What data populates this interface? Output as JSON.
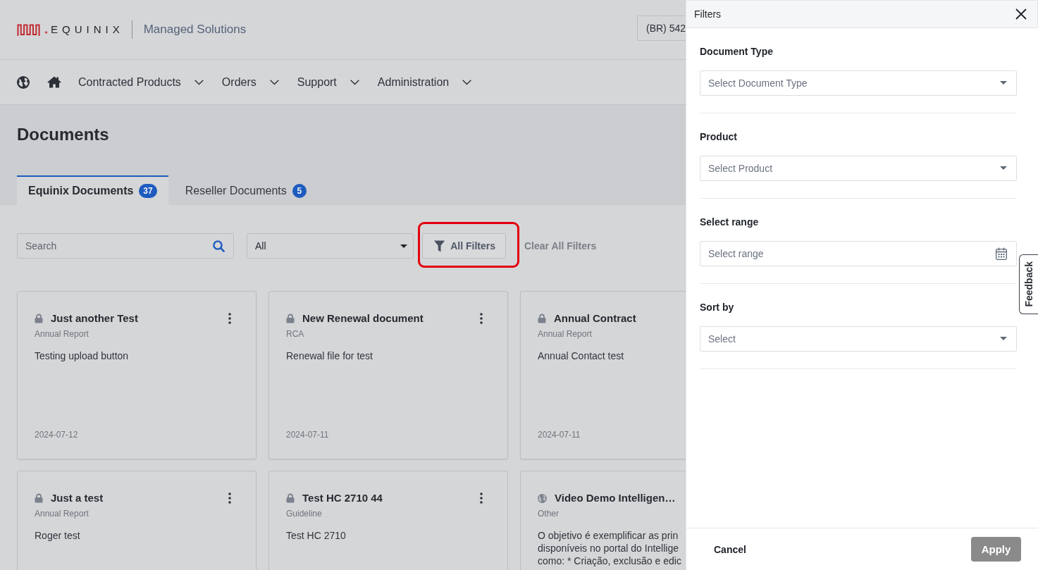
{
  "header": {
    "logo_text": "EQUINIX",
    "product_name": "Managed Solutions",
    "account": "(BR) 542"
  },
  "nav": {
    "items": [
      "Contracted Products",
      "Orders",
      "Support",
      "Administration"
    ]
  },
  "page": {
    "title": "Documents"
  },
  "tabs": [
    {
      "label": "Equinix Documents",
      "count": "37",
      "selected": true
    },
    {
      "label": "Reseller Documents",
      "count": "5",
      "selected": false
    }
  ],
  "toolbar": {
    "search": {
      "placeholder": "Search"
    },
    "type_filter": {
      "value": "All"
    },
    "all_filters": {
      "label": "All Filters",
      "highlighted": true
    },
    "clear_filters": {
      "label": "Clear All Filters"
    }
  },
  "cards": [
    {
      "title": "Just another Test",
      "locked": true,
      "type": "Annual Report",
      "description": "Testing upload button",
      "date": "2024-07-12"
    },
    {
      "title": "New Renewal document",
      "locked": true,
      "type": "RCA",
      "description": "Renewal file for test",
      "date": "2024-07-11"
    },
    {
      "title": "Annual Contract",
      "locked": true,
      "type": "Annual Report",
      "description": "Annual Contact test",
      "date": "2024-07-11"
    },
    {
      "title": "Just a test",
      "locked": true,
      "type": "Annual Report",
      "description": "Roger test"
    },
    {
      "title": "Test HC 2710 44",
      "locked": true,
      "type": "Guideline",
      "description": "Test HC 2710"
    },
    {
      "title": "Video Demo Intelligen…",
      "locked": false,
      "type": "Other",
      "description": "O objetivo é exemplificar as prin\ndisponíveis no portal do Intellige\ncomo: * Criação, exclusão e edic"
    }
  ],
  "filter_panel": {
    "title": "Filters",
    "sections": [
      {
        "label": "Document Type",
        "kind": "select",
        "placeholder": "Select Document Type"
      },
      {
        "label": "Product",
        "kind": "select",
        "placeholder": "Select Product"
      },
      {
        "label": "Select range",
        "kind": "date",
        "placeholder": "Select range"
      },
      {
        "label": "Sort by",
        "kind": "select",
        "placeholder": "Select"
      }
    ],
    "cancel": "Cancel",
    "apply": {
      "label": "Apply",
      "disabled": true
    }
  },
  "feedback": {
    "label": "Feedback"
  }
}
